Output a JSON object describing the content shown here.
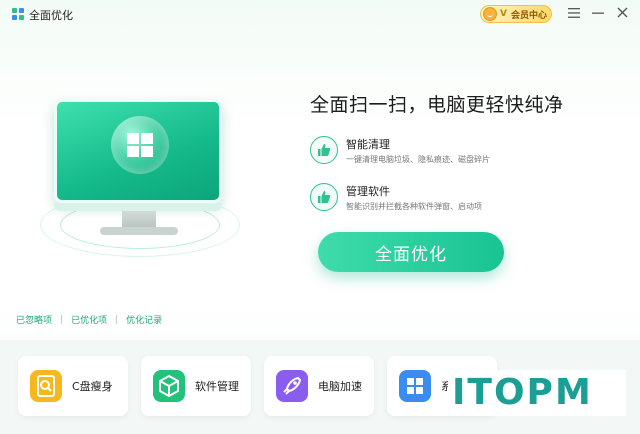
{
  "titlebar": {
    "title": "全面优化",
    "vip_label": "会员中心",
    "vip_v": "V",
    "menu_icon": "menu-icon",
    "minimize_icon": "minimize-icon",
    "close_icon": "close-icon"
  },
  "hero": {
    "headline": "全面扫一扫，电脑更轻快纯净",
    "features": [
      {
        "title": "智能清理",
        "desc": "一键清理电脑垃圾、隐私痕迹、磁盘碎片",
        "icon": "thumbs-up-icon"
      },
      {
        "title": "管理软件",
        "desc": "智能识别并拦截各种软件弹窗、启动项",
        "icon": "thumbs-up-icon"
      }
    ],
    "primary_button": "全面优化"
  },
  "links": [
    "已忽略项",
    "已优化项",
    "优化记录"
  ],
  "tools": [
    {
      "label": "C盘瘦身",
      "icon": "disk-search-icon",
      "color": "#f5b81e"
    },
    {
      "label": "软件管理",
      "icon": "box-icon",
      "color": "#22c27a"
    },
    {
      "label": "电脑加速",
      "icon": "rocket-icon",
      "color": "#8a5cf0"
    },
    {
      "label": "系",
      "icon": "windows-icon",
      "color": "#3a8df0"
    }
  ],
  "watermark": "ITOPM",
  "colors": {
    "accent": "#19c393",
    "link": "#1aa97c",
    "vip": "#ffd86a"
  }
}
